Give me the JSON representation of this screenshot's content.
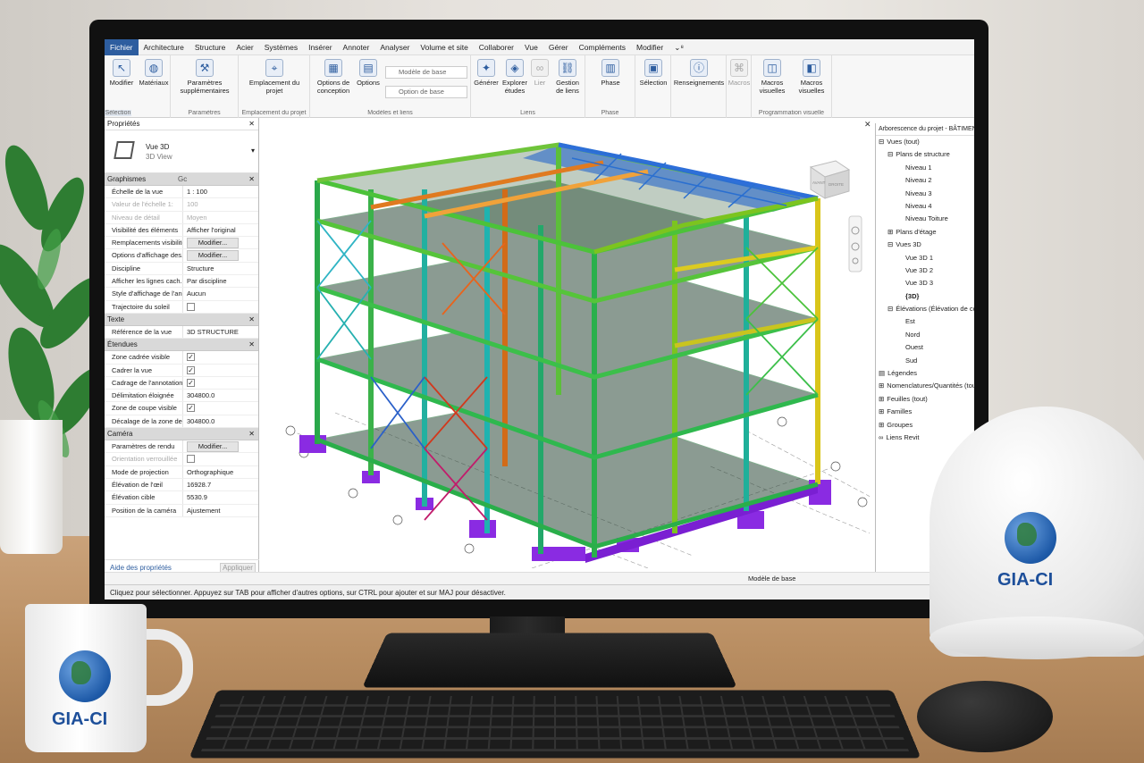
{
  "menu": [
    "Fichier",
    "Architecture",
    "Structure",
    "Acier",
    "Systèmes",
    "Insérer",
    "Annoter",
    "Analyser",
    "Volume et site",
    "Collaborer",
    "Vue",
    "Gérer",
    "Compléments",
    "Modifier",
    "⌄⁸"
  ],
  "ribbon": {
    "modify": "Modifier",
    "materials": "Matériaux",
    "selection_group": "Sélection",
    "additional_params": "Paramètres supplémentaires",
    "params_group": "Paramètres",
    "project_location": "Emplacement du projet",
    "project_location_group": "Emplacement du projet",
    "design_options": "Options de conception",
    "options": "Options",
    "main_model": "Modèle de base",
    "main_model_2": "Option de base",
    "gen": "Générer",
    "explore_studies": "Explorer études",
    "link": "Lier",
    "links_management": "Gestion de liens",
    "links_group": "Liens",
    "models_group": "Modèles et liens",
    "phase": "Phase",
    "phase_group": "Phase",
    "selection": "Sélection",
    "info": "Renseignements",
    "macros": "Macros",
    "macro_manager": "Macros visuelles",
    "visual_macros": "Macros visuelles",
    "macro_group": "Programmation visuelle"
  },
  "properties": {
    "title": "Propriétés",
    "type_name": "Vue 3D",
    "type_sub": "3D View",
    "group_code": "Gc",
    "sections": [
      {
        "name": "Graphismes",
        "rows": [
          {
            "k": "Échelle de la vue",
            "v": "1 : 100"
          },
          {
            "k": "Valeur de l'échelle  1:",
            "v": "100",
            "dim": true
          },
          {
            "k": "Niveau de détail",
            "v": "Moyen",
            "dim": true
          },
          {
            "k": "Visibilité des éléments",
            "v": "Afficher l'original"
          },
          {
            "k": "Remplacements visibilité...",
            "v": "Modifier...",
            "btn": true
          },
          {
            "k": "Options d'affichage des...",
            "v": "Modifier...",
            "btn": true
          },
          {
            "k": "Discipline",
            "v": "Structure"
          },
          {
            "k": "Afficher les lignes cach...",
            "v": "Par discipline"
          },
          {
            "k": "Style d'affichage de l'an...",
            "v": "Aucun"
          },
          {
            "k": "Trajectoire du soleil",
            "v": "",
            "chk": ""
          }
        ]
      },
      {
        "name": "Texte",
        "rows": [
          {
            "k": "Référence de la vue",
            "v": "3D STRUCTURE"
          }
        ]
      },
      {
        "name": "Étendues",
        "rows": [
          {
            "k": "Zone cadrée visible",
            "v": "",
            "chk": "✓"
          },
          {
            "k": "Cadrer la vue",
            "v": "",
            "chk": "✓"
          },
          {
            "k": "Cadrage de l'annotation",
            "v": "",
            "chk": "✓"
          },
          {
            "k": "Délimitation éloignée",
            "v": "304800.0"
          },
          {
            "k": "Zone de coupe visible",
            "v": "",
            "chk": "✓"
          },
          {
            "k": "Décalage de la zone de...",
            "v": "304800.0"
          }
        ]
      },
      {
        "name": "Caméra",
        "rows": [
          {
            "k": "Paramètres de rendu",
            "v": "Modifier...",
            "btn": true
          },
          {
            "k": "Orientation verrouillée",
            "v": "",
            "chk": "",
            "dim": true
          },
          {
            "k": "Mode de projection",
            "v": "Orthographique"
          },
          {
            "k": "Élévation de l'œil",
            "v": "16928.7"
          },
          {
            "k": "Élévation cible",
            "v": "5530.9"
          },
          {
            "k": "Position de la caméra",
            "v": "Ajustement"
          }
        ]
      }
    ],
    "help": "Aide des propriétés",
    "apply": "Appliquer"
  },
  "viewcube": {
    "front": "AVANT",
    "right": "DROITE"
  },
  "browser": {
    "title": "Arborescence du projet - BÂTIMENT B",
    "items": [
      {
        "label": "Vues (tout)",
        "indent": 0,
        "icon": "⊟"
      },
      {
        "label": "Plans de structure",
        "indent": 1,
        "icon": "⊟"
      },
      {
        "label": "Niveau 1",
        "indent": 3
      },
      {
        "label": "Niveau 2",
        "indent": 3
      },
      {
        "label": "Niveau 3",
        "indent": 3
      },
      {
        "label": "Niveau 4",
        "indent": 3
      },
      {
        "label": "Niveau Toiture",
        "indent": 3
      },
      {
        "label": "Plans d'étage",
        "indent": 1,
        "icon": "⊞"
      },
      {
        "label": "Vues 3D",
        "indent": 1,
        "icon": "⊟"
      },
      {
        "label": "Vue 3D 1",
        "indent": 3
      },
      {
        "label": "Vue 3D 2",
        "indent": 3
      },
      {
        "label": "Vue 3D 3",
        "indent": 3
      },
      {
        "label": "{3D}",
        "indent": 3,
        "bold": true
      },
      {
        "label": "Élévations (Élévation de construction)",
        "indent": 1,
        "icon": "⊟"
      },
      {
        "label": "Est",
        "indent": 3
      },
      {
        "label": "Nord",
        "indent": 3
      },
      {
        "label": "Ouest",
        "indent": 3
      },
      {
        "label": "Sud",
        "indent": 3
      },
      {
        "label": "Légendes",
        "indent": 0,
        "icon": "▤"
      },
      {
        "label": "Nomenclatures/Quantités (tout)",
        "indent": 0,
        "icon": "⊞"
      },
      {
        "label": "Feuilles (tout)",
        "indent": 0,
        "icon": "⊞"
      },
      {
        "label": "Familles",
        "indent": 0,
        "icon": "⊞"
      },
      {
        "label": "Groupes",
        "indent": 0,
        "icon": "⊞"
      },
      {
        "label": "Liens Revit",
        "indent": 0,
        "icon": "∞"
      }
    ]
  },
  "view_controls": {
    "model": "Modèle de base"
  },
  "status": "Cliquez pour sélectionner. Appuyez sur TAB pour afficher d'autres options, sur CTRL pour ajouter et sur MAJ pour désactiver.",
  "brand": "GIA-CI",
  "colors": {
    "accent": "#2d5d9f",
    "brand": "#1d4f9a"
  }
}
